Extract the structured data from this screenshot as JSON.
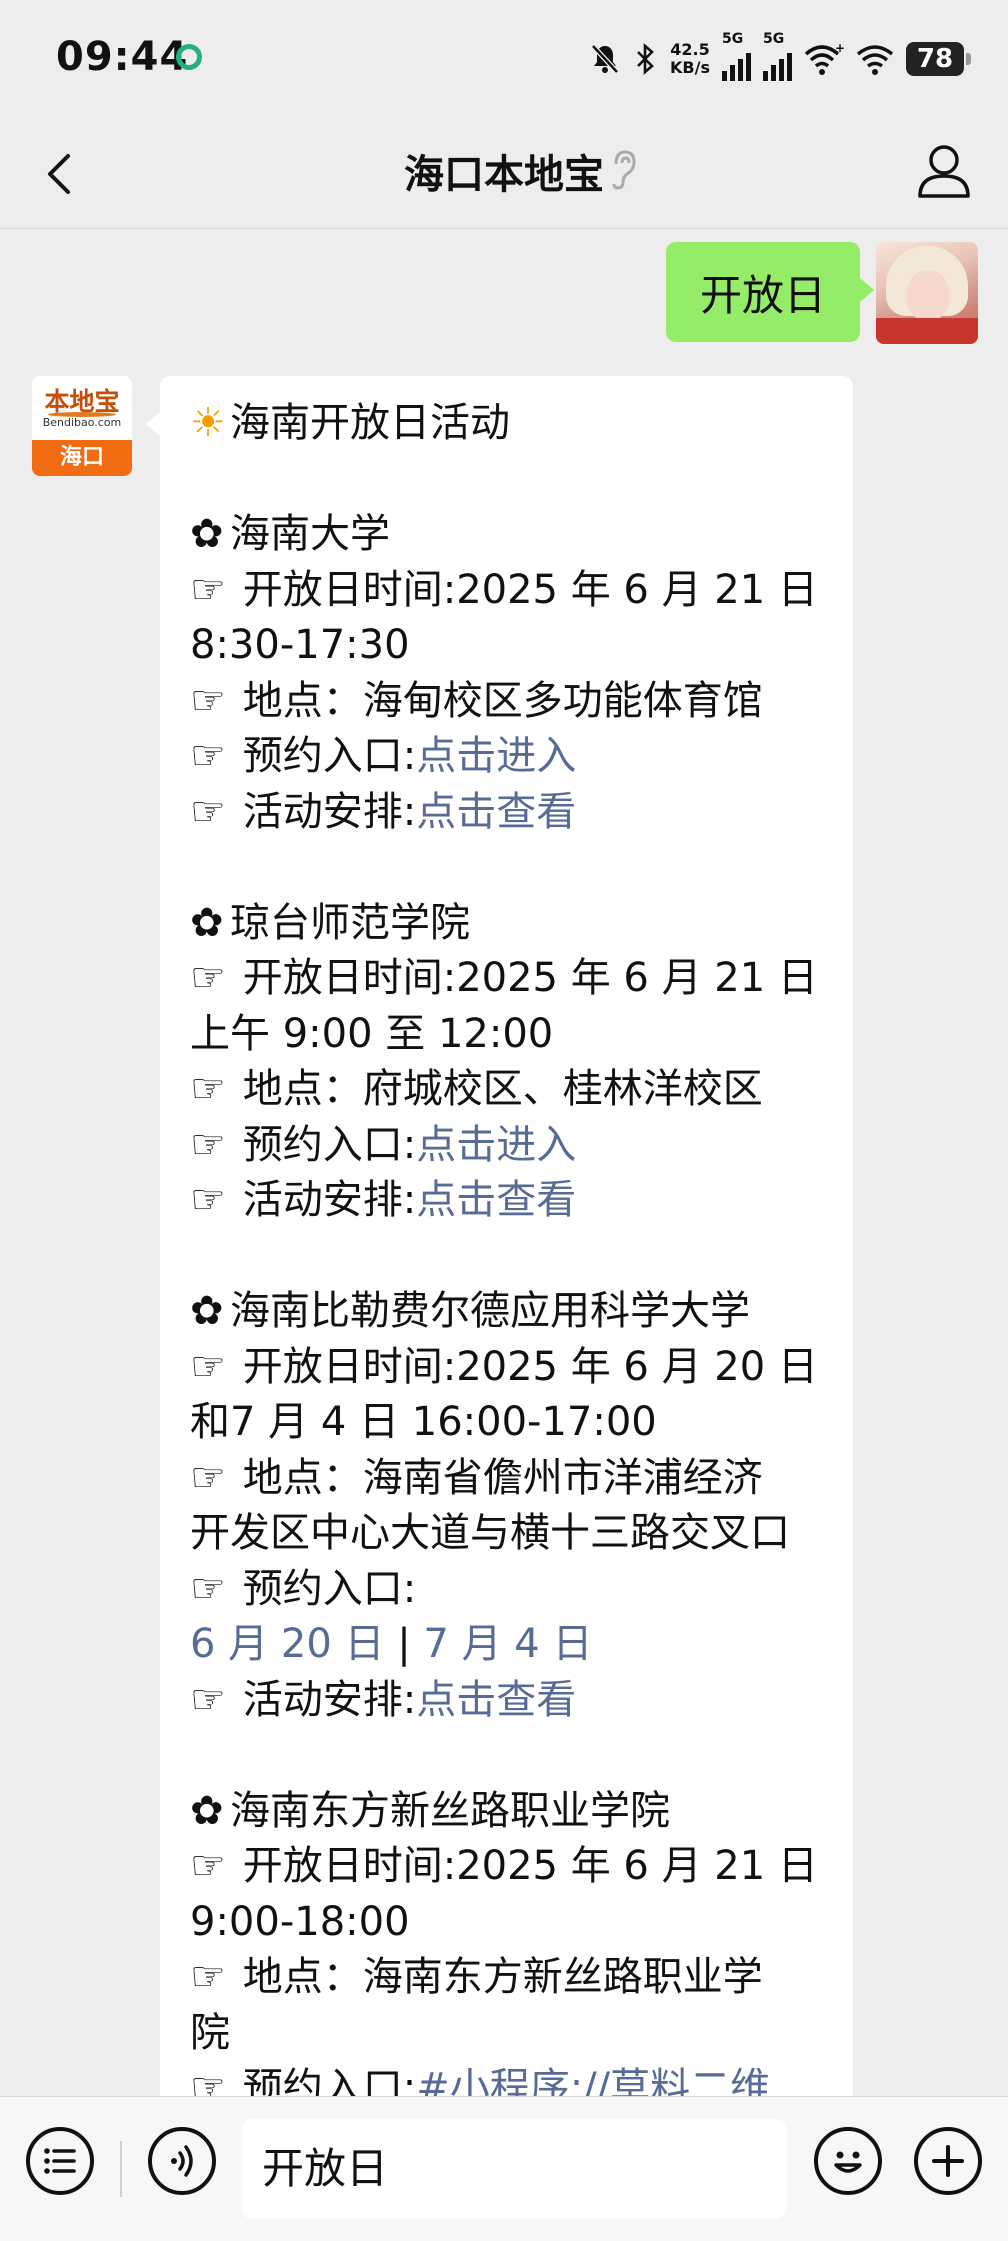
{
  "status": {
    "time": "09:44",
    "net_speed_value": "42.5",
    "net_speed_unit": "KB/s",
    "sim1": "5G",
    "sim2": "5G",
    "battery": "78"
  },
  "header": {
    "title": "海口本地宝"
  },
  "messages": {
    "sent": "开放日",
    "bot_avatar": {
      "logo_text": "本地宝",
      "logo_sub": "Bendibao.com",
      "city": "海口"
    },
    "reply": {
      "heading": "海南开放日活动",
      "s1": {
        "name": "海南大学",
        "time_label": "开放日时间:2025 年 6 月 21 日",
        "time_cont": "8:30-17:30",
        "place": "地点：海甸校区多功能体育馆",
        "reserve_label": "预约入口:",
        "reserve_link": "点击进入",
        "arrange_label": "活动安排:",
        "arrange_link": "点击查看"
      },
      "s2": {
        "name": "琼台师范学院",
        "time_label": "开放日时间:2025 年 6 月 21 日",
        "time_cont": "上午 9:00 至 12:00",
        "place": "地点：府城校区、桂林洋校区",
        "reserve_label": "预约入口:",
        "reserve_link": "点击进入",
        "arrange_label": "活动安排:",
        "arrange_link": "点击查看"
      },
      "s3": {
        "name": "海南比勒费尔德应用科学大学",
        "time_label": "开放日时间:2025 年 6 月 20 日",
        "time_cont": "和7 月 4 日 16:00-17:00",
        "place": "地点：海南省儋州市洋浦经济",
        "place_cont": "开发区中心大道与横十三路交叉口",
        "reserve_label": "预约入口:",
        "reserve_link1": "6 月 20 日",
        "reserve_sep": "|",
        "reserve_link2": "7 月 4 日",
        "arrange_label": "活动安排:",
        "arrange_link": "点击查看"
      },
      "s4": {
        "name": "海南东方新丝路职业学院",
        "time_label": "开放日时间:2025 年 6 月 21 日",
        "time_cont": "9:00-18:00",
        "place": "地点：海南东方新丝路职业学",
        "place_cont": "院",
        "reserve_label": "预约入口:",
        "reserve_link": "#小程序://草料二维"
      },
      "bullet": "✿",
      "pointer": "☞",
      "sun": "☀"
    }
  },
  "input": {
    "value": "开放日"
  },
  "colors": {
    "sent_bubble": "#95ec69",
    "link": "#576b95",
    "background": "#ededed"
  }
}
